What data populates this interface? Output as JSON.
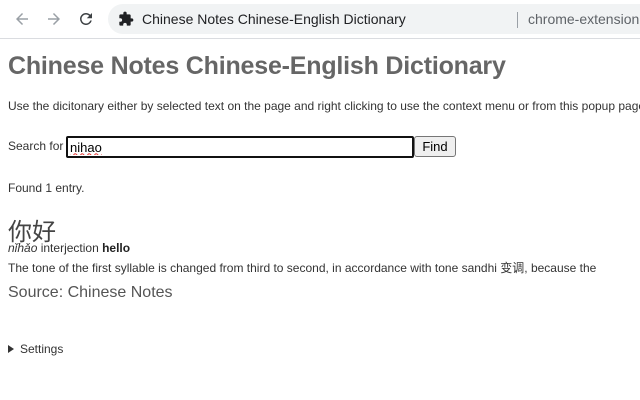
{
  "browser": {
    "tab_title": "Chinese Notes Chinese-English Dictionary",
    "url": "chrome-extension://gefbidlaangmaf",
    "icons": {
      "back": "back-arrow-icon",
      "forward": "forward-arrow-icon",
      "reload": "reload-icon",
      "extension": "puzzle-piece-icon"
    }
  },
  "page": {
    "title": "Chinese Notes Chinese-English Dictionary",
    "intro": "Use the dicitonary either by selected text on the page and right clicking to use the context menu or from this popup page",
    "search": {
      "label": "Search for",
      "value": "nihao",
      "button_label": "Find"
    },
    "results": {
      "summary": "Found 1 entry.",
      "entry": {
        "headword": "你好",
        "pinyin": "nǐhǎo",
        "grammar": "interjection",
        "english": "hello",
        "notes": "The tone of the first syllable is changed from third to second, in accordance with tone sandhi 变调, because the"
      },
      "source": "Source: Chinese Notes"
    },
    "settings_label": "Settings"
  },
  "colors": {
    "title_text": "#666666",
    "toolbar_bg": "#ffffff",
    "omnibox_bg": "#f1f3f4",
    "input_border": "#111111"
  }
}
